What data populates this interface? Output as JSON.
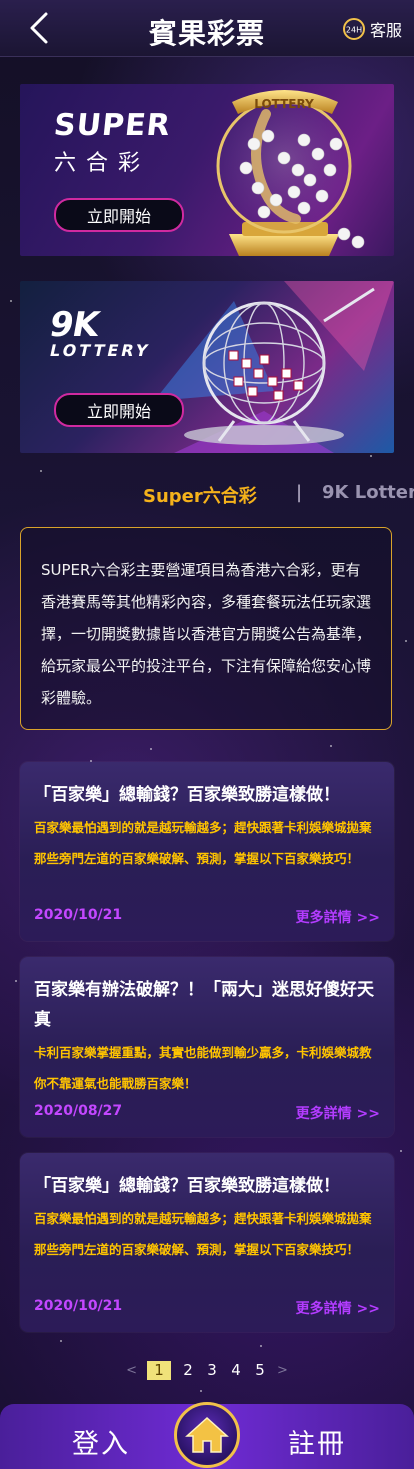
{
  "header": {
    "title": "賓果彩票",
    "service_badge": "24H",
    "service_label": "客服"
  },
  "banners": [
    {
      "brand_line1": "SUPER",
      "brand_line2": "六合彩",
      "machine_label": "LOTTERY",
      "button_label": "立即開始"
    },
    {
      "brand_line1": "9K",
      "brand_line2": "LOTTERY",
      "button_label": "立即開始"
    }
  ],
  "tabs": {
    "active": "Super六合彩",
    "separator": "|",
    "inactive": "9K Lotter"
  },
  "description": "SUPER六合彩主要營運項目為香港六合彩，更有香港賽馬等其他精彩內容，多種套餐玩法任玩家選擇，一切開獎數據皆以香港官方開獎公告為基準，給玩家最公平的投注平台，下注有保障給您安心博彩體驗。",
  "news": [
    {
      "title": "「百家樂」總輸錢？百家樂致勝這樣做！",
      "summary": "百家樂最怕遇到的就是越玩輸越多；趕快跟著卡利娛樂城拋棄那些旁門左道的百家樂破解、預測，掌握以下百家樂技巧！",
      "date": "2020/10/21",
      "more": "更多詳情 >>"
    },
    {
      "title": "百家樂有辦法破解？！「兩大」迷思好傻好天真",
      "summary": "卡利百家樂掌握重點，其實也能做到輸少贏多，卡利娛樂城教你不靠運氣也能戰勝百家樂！",
      "date": "2020/08/27",
      "more": "更多詳情 >>"
    },
    {
      "title": "「百家樂」總輸錢？百家樂致勝這樣做！",
      "summary": "百家樂最怕遇到的就是越玩輸越多；趕快跟著卡利娛樂城拋棄那些旁門左道的百家樂破解、預測，掌握以下百家樂技巧！",
      "date": "2020/10/21",
      "more": "更多詳情 >>"
    }
  ],
  "pagination": {
    "prev": "<",
    "pages": [
      "1",
      "2",
      "3",
      "4",
      "5"
    ],
    "current": "1",
    "next": ">"
  },
  "bottom_nav": {
    "login": "登入",
    "register": "註冊"
  },
  "colors": {
    "accent_gold": "#f5b21b",
    "news_text": "#ffc400",
    "link_purple": "#b33cff",
    "bottom_bar": "#6f2bd4"
  }
}
